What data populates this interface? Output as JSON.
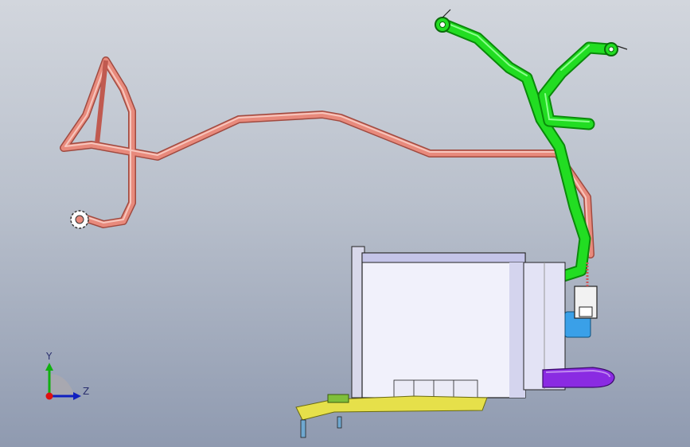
{
  "viewport": {
    "background_top": "#d2d6dd",
    "background_bottom": "#8f9ab0"
  },
  "parts": {
    "salmon_hose_color": "#e88a7c",
    "green_hose_color": "#22dd22",
    "canister_color": "#f1f1fb",
    "purple_pipe_color": "#8a2be2",
    "bracket_color": "#e6e04a",
    "connector_color": "#3aa0e8"
  },
  "triad": {
    "y_label": "Y",
    "z_label": "Z",
    "x_color": "#e01010",
    "y_color": "#10b010",
    "z_color": "#1020c0"
  }
}
